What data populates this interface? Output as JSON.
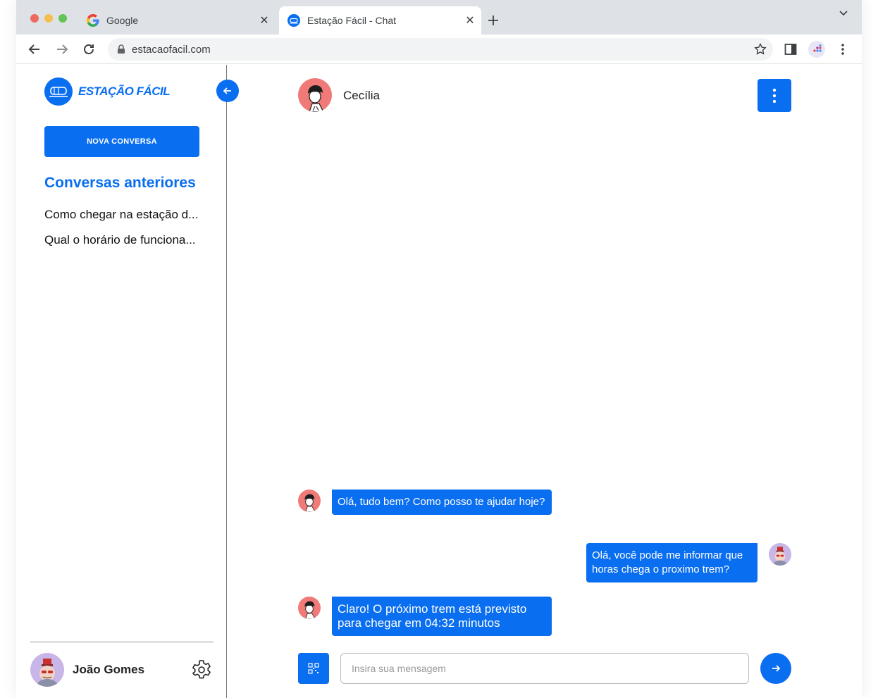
{
  "browser": {
    "tabs": [
      {
        "title": "Google",
        "favicon": "google-icon"
      },
      {
        "title": "Estação Fácil - Chat",
        "favicon": "estacao-facil-icon"
      }
    ],
    "url": "estacaofacil.com"
  },
  "app": {
    "brand": "ESTAÇÃO FÁCIL",
    "accent_color": "#0a6ef0",
    "new_chat_label": "NOVA CONVERSA",
    "history_title": "Conversas anteriores",
    "history": [
      "Como chegar na estação d...",
      "Qual o horário de funciona..."
    ],
    "user_name": "João Gomes"
  },
  "chat": {
    "contact_name": "Cecília",
    "messages": [
      {
        "from": "bot",
        "text": "Olá, tudo bem? Como posso te ajudar hoje?"
      },
      {
        "from": "user",
        "text": "Olá, você pode me informar que horas chega o proximo trem?"
      },
      {
        "from": "bot",
        "text": "Claro! O próximo trem está previsto para chegar em 04:32 minutos"
      }
    ],
    "input_placeholder": "Insira sua mensagem"
  }
}
